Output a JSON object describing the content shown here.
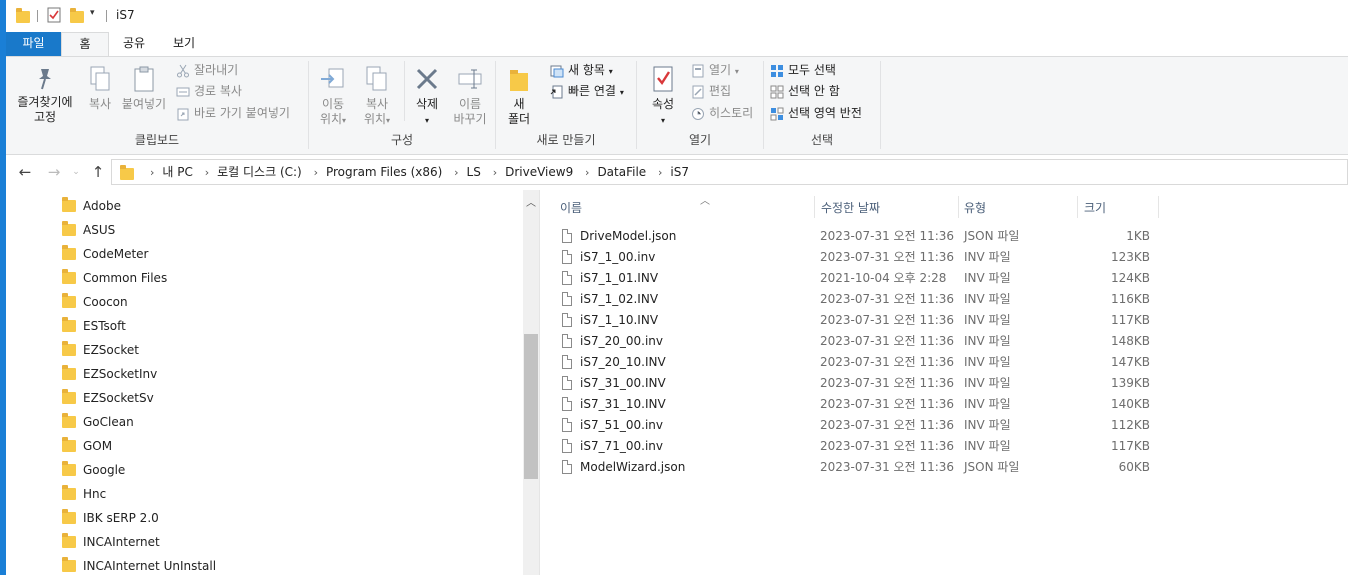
{
  "window": {
    "title": "iS7"
  },
  "tabs": [
    {
      "label": "파일"
    },
    {
      "label": "홈"
    },
    {
      "label": "공유"
    },
    {
      "label": "보기"
    }
  ],
  "ribbon": {
    "clipboard": {
      "label": "클립보드",
      "pin": "즐겨찾기에\n고정",
      "pin_l1": "즐겨찾기에",
      "pin_l2": "고정",
      "copy": "복사",
      "paste": "붙여넣기",
      "cut": "잘라내기",
      "copy_path": "경로 복사",
      "paste_shortcut": "바로 가기 붙여넣기"
    },
    "organize": {
      "label": "구성",
      "move_l1": "이동",
      "move_l2": "위치",
      "copyto_l1": "복사",
      "copyto_l2": "위치",
      "delete": "삭제",
      "rename_l1": "이름",
      "rename_l2": "바꾸기"
    },
    "new": {
      "label": "새로 만들기",
      "folder_l1": "새",
      "folder_l2": "폴더",
      "new_item": "새 항목",
      "easy_access": "빠른 연결"
    },
    "open": {
      "label": "열기",
      "properties": "속성",
      "open": "열기",
      "edit": "편집",
      "history": "히스토리"
    },
    "select": {
      "label": "선택",
      "select_all": "모두 선택",
      "select_none": "선택 안 함",
      "invert": "선택 영역 반전"
    }
  },
  "breadcrumbs": [
    "내 PC",
    "로컬 디스크 (C:)",
    "Program Files (x86)",
    "LS",
    "DriveView9",
    "DataFile",
    "iS7"
  ],
  "nav_items": [
    "Adobe",
    "ASUS",
    "CodeMeter",
    "Common Files",
    "Coocon",
    "ESTsoft",
    "EZSocket",
    "EZSocketInv",
    "EZSocketSv",
    "GoClean",
    "GOM",
    "Google",
    "Hnc",
    "IBK sERP 2.0",
    "INCAInternet",
    "INCAInternet UnInstall"
  ],
  "columns": {
    "name": "이름",
    "date": "수정한 날짜",
    "type": "유형",
    "size": "크기"
  },
  "files": [
    {
      "name": "DriveModel.json",
      "date": "2023-07-31 오전 11:36",
      "type": "JSON 파일",
      "size": "1KB"
    },
    {
      "name": "iS7_1_00.inv",
      "date": "2023-07-31 오전 11:36",
      "type": "INV 파일",
      "size": "123KB"
    },
    {
      "name": "iS7_1_01.INV",
      "date": "2021-10-04 오후 2:28",
      "type": "INV 파일",
      "size": "124KB"
    },
    {
      "name": "iS7_1_02.INV",
      "date": "2023-07-31 오전 11:36",
      "type": "INV 파일",
      "size": "116KB"
    },
    {
      "name": "iS7_1_10.INV",
      "date": "2023-07-31 오전 11:36",
      "type": "INV 파일",
      "size": "117KB"
    },
    {
      "name": "iS7_20_00.inv",
      "date": "2023-07-31 오전 11:36",
      "type": "INV 파일",
      "size": "148KB"
    },
    {
      "name": "iS7_20_10.INV",
      "date": "2023-07-31 오전 11:36",
      "type": "INV 파일",
      "size": "147KB"
    },
    {
      "name": "iS7_31_00.INV",
      "date": "2023-07-31 오전 11:36",
      "type": "INV 파일",
      "size": "139KB"
    },
    {
      "name": "iS7_31_10.INV",
      "date": "2023-07-31 오전 11:36",
      "type": "INV 파일",
      "size": "140KB"
    },
    {
      "name": "iS7_51_00.inv",
      "date": "2023-07-31 오전 11:36",
      "type": "INV 파일",
      "size": "112KB"
    },
    {
      "name": "iS7_71_00.inv",
      "date": "2023-07-31 오전 11:36",
      "type": "INV 파일",
      "size": "117KB"
    },
    {
      "name": "ModelWizard.json",
      "date": "2023-07-31 오전 11:36",
      "type": "JSON 파일",
      "size": "60KB"
    }
  ],
  "colors": {
    "accent": "#1979ca",
    "folder": "#f7c948"
  }
}
